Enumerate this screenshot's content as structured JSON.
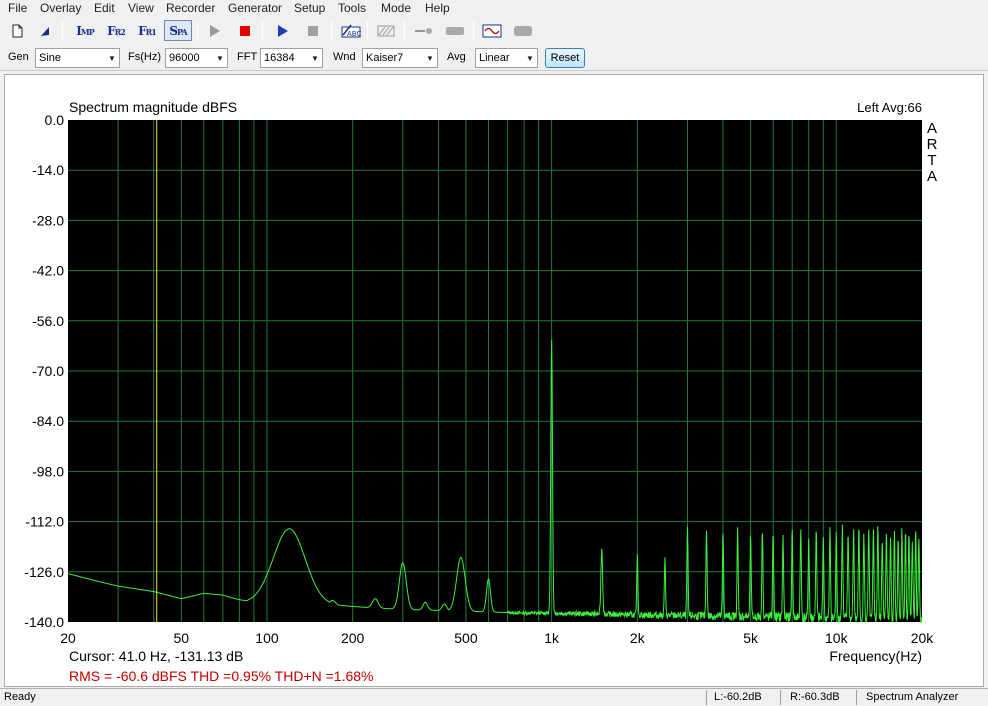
{
  "menu": [
    "File",
    "Overlay",
    "Edit",
    "View",
    "Recorder",
    "Generator",
    "Setup",
    "Tools",
    "Mode",
    "Help"
  ],
  "controls": {
    "gen_label": "Gen",
    "gen_value": "Sine",
    "fs_label": "Fs(Hz)",
    "fs_value": "96000",
    "fft_label": "FFT",
    "fft_value": "16384",
    "wnd_label": "Wnd",
    "wnd_value": "Kaiser7",
    "avg_label": "Avg",
    "avg_value": "Linear",
    "reset_label": "Reset"
  },
  "plot": {
    "title": "Spectrum magnitude dBFS",
    "channel_info": "Left  Avg:66",
    "brand_letters": [
      "A",
      "R",
      "T",
      "A"
    ],
    "cursor_text": "Cursor:   41.0 Hz, -131.13 dB",
    "cursor_freq": 41.0,
    "measurements_text": "RMS =  -60.6 dBFS   THD =0.95%   THD+N =1.68%",
    "colors": {
      "background": "#000000",
      "grid": "#1d7a3a",
      "trace": "#3cf03c",
      "cursor": "#e6e62a",
      "measurements": "#c00000"
    }
  },
  "chart_data": {
    "type": "line",
    "title": "Spectrum magnitude dBFS",
    "xlabel": "Frequency(Hz)",
    "ylabel": "",
    "xscale": "log",
    "xlim": [
      20,
      20000
    ],
    "ylim": [
      -140,
      0
    ],
    "x_ticks": [
      20,
      50,
      100,
      200,
      500,
      1000,
      2000,
      5000,
      10000,
      20000
    ],
    "x_tick_labels": [
      "20",
      "50",
      "100",
      "200",
      "500",
      "1k",
      "2k",
      "5k",
      "10k",
      "20k"
    ],
    "y_ticks": [
      0,
      -14,
      -28,
      -42,
      -56,
      -70,
      -84,
      -98,
      -112,
      -126,
      -140
    ],
    "y_tick_labels": [
      "0.0",
      "-14.0",
      "-28.0",
      "-42.0",
      "-56.0",
      "-70.0",
      "-84.0",
      "-98.0",
      "-112.0",
      "-126.0",
      "-140.0"
    ],
    "grid": true,
    "baseline": [
      [
        20,
        -126.5
      ],
      [
        25,
        -128.5
      ],
      [
        30,
        -130
      ],
      [
        40,
        -131.5
      ],
      [
        50,
        -133.5
      ],
      [
        60,
        -132
      ],
      [
        70,
        -132.5
      ],
      [
        85,
        -134.5
      ],
      [
        100,
        -134
      ],
      [
        230,
        -136
      ],
      [
        300,
        -136.5
      ],
      [
        500,
        -137
      ],
      [
        800,
        -137.5
      ],
      [
        1000,
        -137.5
      ],
      [
        2000,
        -138
      ],
      [
        5000,
        -138.5
      ],
      [
        10000,
        -139
      ],
      [
        20000,
        -139.5
      ]
    ],
    "peaks": [
      {
        "f": 120,
        "db": -114,
        "w": 0.055
      },
      {
        "f": 170,
        "db": -134,
        "w": 0.01
      },
      {
        "f": 240,
        "db": -133.5,
        "w": 0.01
      },
      {
        "f": 300,
        "db": -123.5,
        "w": 0.012
      },
      {
        "f": 360,
        "db": -134.5,
        "w": 0.008
      },
      {
        "f": 420,
        "db": -135,
        "w": 0.008
      },
      {
        "f": 480,
        "db": -122,
        "w": 0.015
      },
      {
        "f": 600,
        "db": -128,
        "w": 0.007
      },
      {
        "f": 1000,
        "db": -61,
        "w": 0.003
      },
      {
        "f": 1500,
        "db": -119.5,
        "w": 0.003
      },
      {
        "f": 2000,
        "db": -121.5,
        "w": 0.002
      },
      {
        "f": 2500,
        "db": -122.5,
        "w": 0.002
      },
      {
        "f": 3000,
        "db": -113.5,
        "w": 0.002
      },
      {
        "f": 3500,
        "db": -113.5,
        "w": 0.002
      },
      {
        "f": 4000,
        "db": -115,
        "w": 0.002
      },
      {
        "f": 4500,
        "db": -114.5,
        "w": 0.002
      },
      {
        "f": 5000,
        "db": -116,
        "w": 0.002
      },
      {
        "f": 5500,
        "db": -114,
        "w": 0.002
      },
      {
        "f": 6000,
        "db": -115,
        "w": 0.002
      },
      {
        "f": 6500,
        "db": -116.5,
        "w": 0.002
      },
      {
        "f": 7000,
        "db": -114.5,
        "w": 0.002
      },
      {
        "f": 7500,
        "db": -114,
        "w": 0.002
      },
      {
        "f": 8000,
        "db": -116.5,
        "w": 0.002
      },
      {
        "f": 8500,
        "db": -114.5,
        "w": 0.002
      },
      {
        "f": 9000,
        "db": -116,
        "w": 0.002
      },
      {
        "f": 9500,
        "db": -114.5,
        "w": 0.002
      },
      {
        "f": 10000,
        "db": -115.5,
        "w": 0.002
      },
      {
        "f": 10500,
        "db": -113.5,
        "w": 0.002
      },
      {
        "f": 11000,
        "db": -114.5,
        "w": 0.002
      },
      {
        "f": 11500,
        "db": -115,
        "w": 0.002
      },
      {
        "f": 12000,
        "db": -113.5,
        "w": 0.002
      },
      {
        "f": 12500,
        "db": -116,
        "w": 0.002
      },
      {
        "f": 13000,
        "db": -114.5,
        "w": 0.002
      },
      {
        "f": 13500,
        "db": -115,
        "w": 0.002
      },
      {
        "f": 14000,
        "db": -113.5,
        "w": 0.002
      },
      {
        "f": 14500,
        "db": -116,
        "w": 0.002
      },
      {
        "f": 15000,
        "db": -114,
        "w": 0.002
      },
      {
        "f": 15500,
        "db": -115.5,
        "w": 0.002
      },
      {
        "f": 16000,
        "db": -113.5,
        "w": 0.002
      },
      {
        "f": 16500,
        "db": -116,
        "w": 0.002
      },
      {
        "f": 17000,
        "db": -114.5,
        "w": 0.002
      },
      {
        "f": 17500,
        "db": -115.5,
        "w": 0.002
      },
      {
        "f": 18000,
        "db": -114,
        "w": 0.002
      },
      {
        "f": 18500,
        "db": -117,
        "w": 0.002
      },
      {
        "f": 19000,
        "db": -114,
        "w": 0.002
      },
      {
        "f": 19500,
        "db": -117,
        "w": 0.002
      }
    ]
  },
  "status": {
    "ready": "Ready",
    "left_level": "L:-60.2dB",
    "right_level": "R:-60.3dB",
    "mode": "Spectrum Analyzer"
  }
}
